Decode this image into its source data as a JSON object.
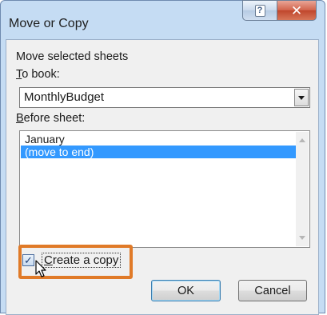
{
  "dialog": {
    "title": "Move or Copy",
    "help_glyph": "?",
    "close_glyph": "✕"
  },
  "content": {
    "heading": "Move selected sheets",
    "to_book_label_u": "T",
    "to_book_label_rest": "o book:",
    "to_book_value": "MonthlyBudget",
    "before_sheet_label_u": "B",
    "before_sheet_label_rest": "efore sheet:",
    "sheets": [
      "January",
      "(move to end)"
    ],
    "selected_sheet": "(move to end)",
    "create_copy_label_u": "C",
    "create_copy_label_rest": "reate a copy",
    "create_copy_checked": true,
    "check_mark": "✓"
  },
  "buttons": {
    "ok": "OK",
    "cancel": "Cancel"
  },
  "colors": {
    "selection": "#3399ff",
    "highlight_box": "#e07a28",
    "window_frame": "#c5dcf3"
  },
  "icons": {
    "help": "help-icon",
    "close": "close-icon",
    "dropdown": "chevron-down-icon",
    "cursor": "mouse-pointer-icon"
  }
}
